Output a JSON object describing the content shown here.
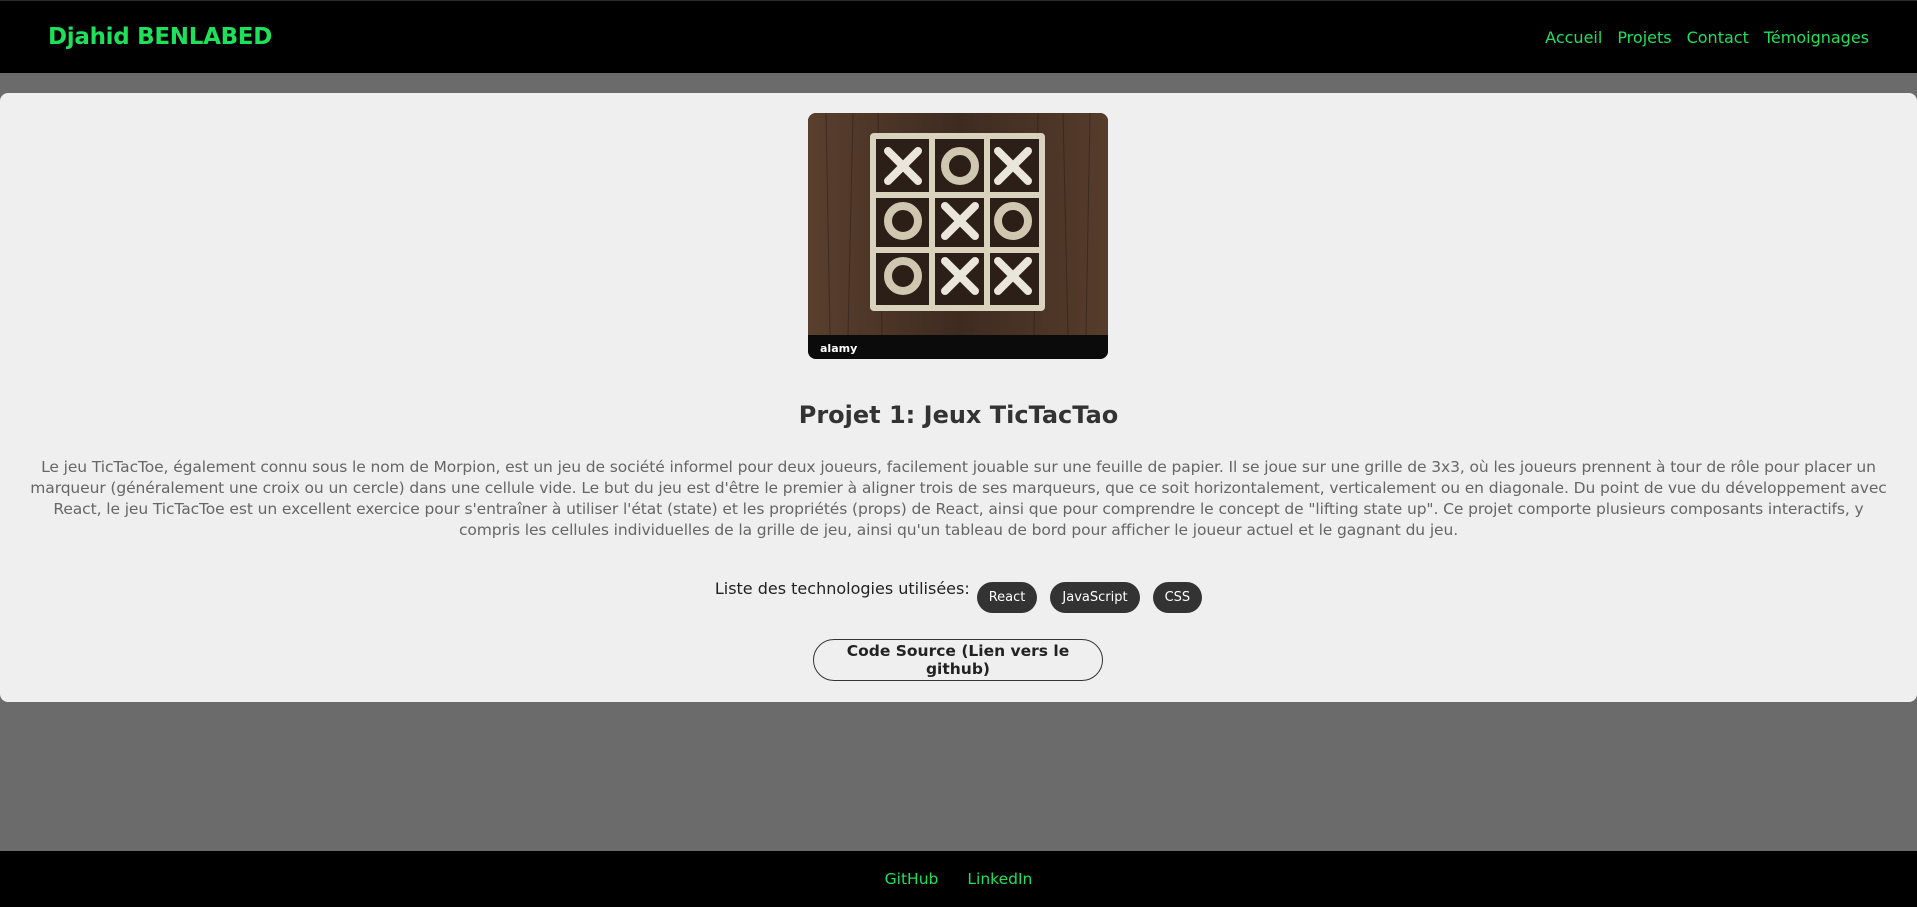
{
  "header": {
    "brand": "Djahid BENLABED",
    "nav": [
      "Accueil",
      "Projets",
      "Contact",
      "Témoignages"
    ]
  },
  "project": {
    "image_caption": "alamy",
    "title": "Projet 1: Jeux TicTacTao",
    "description": "Le jeu TicTacToe, également connu sous le nom de Morpion, est un jeu de société informel pour deux joueurs, facilement jouable sur une feuille de papier. Il se joue sur une grille de 3x3, où les joueurs prennent à tour de rôle pour placer un marqueur (généralement une croix ou un cercle) dans une cellule vide. Le but du jeu est d'être le premier à aligner trois de ses marqueurs, que ce soit horizontalement, verticalement ou en diagonale. Du point de vue du développement avec React, le jeu TicTacToe est un excellent exercice pour s'entraîner à utiliser l'état (state) et les propriétés (props) de React, ainsi que pour comprendre le concept de \"lifting state up\". Ce projet comporte plusieurs composants interactifs, y compris les cellules individuelles de la grille de jeu, ainsi qu'un tableau de bord pour afficher le joueur actuel et le gagnant du jeu.",
    "tech_label": "Liste des technologies utilisées:",
    "technologies": [
      "React",
      "JavaScript",
      "CSS"
    ],
    "source_button": "Code Source (Lien vers le github)"
  },
  "footer": {
    "links": [
      "GitHub",
      "LinkedIn"
    ]
  },
  "colors": {
    "accent": "#1fe05a",
    "page_bg": "#6b6b6b",
    "card_bg": "#efefef",
    "bar_bg": "#000000",
    "badge_bg": "#333333"
  }
}
